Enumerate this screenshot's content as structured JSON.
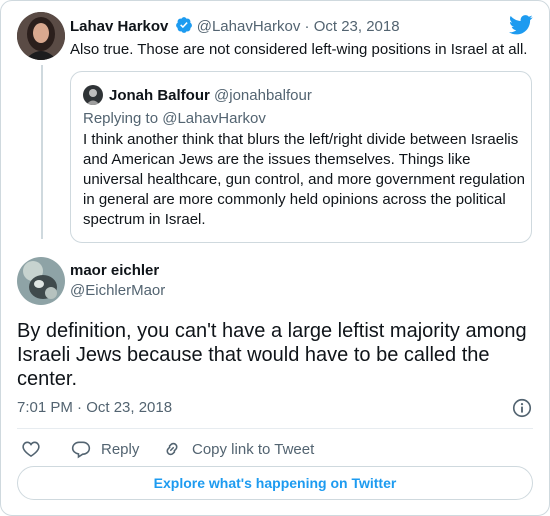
{
  "parent_tweet": {
    "display_name": "Lahav Harkov",
    "verified_icon": "verified-badge-icon",
    "handle": "@LahavHarkov",
    "separator": "·",
    "date": "Oct 23, 2018",
    "text": "Also true. Those are not considered left-wing positions in Israel at all."
  },
  "quoted_tweet": {
    "display_name": "Jonah Balfour",
    "handle": "@jonahbalfour",
    "replying_to": "Replying to @LahavHarkov",
    "text": "I think another think that blurs the left/right divide between Israelis and American Jews are the issues themselves. Things like universal healthcare, gun control, and more government regulation in general are more commonly held opinions across the political spectrum in Israel."
  },
  "main_tweet": {
    "display_name": "maor eichler",
    "handle": "@EichlerMaor",
    "text": "By definition, you can't have a large leftist majority among Israeli Jews because that would have to be called the center.",
    "timestamp": "7:01 PM · Oct 23, 2018"
  },
  "actions": {
    "like_icon": "heart-icon",
    "reply_label": "Reply",
    "copy_link_label": "Copy link to Tweet"
  },
  "footer": {
    "explore_label": "Explore what's happening on Twitter"
  },
  "colors": {
    "brand": "#1d9bf0",
    "text": "#0f1419",
    "muted": "#536471",
    "border": "#cfd9de"
  }
}
